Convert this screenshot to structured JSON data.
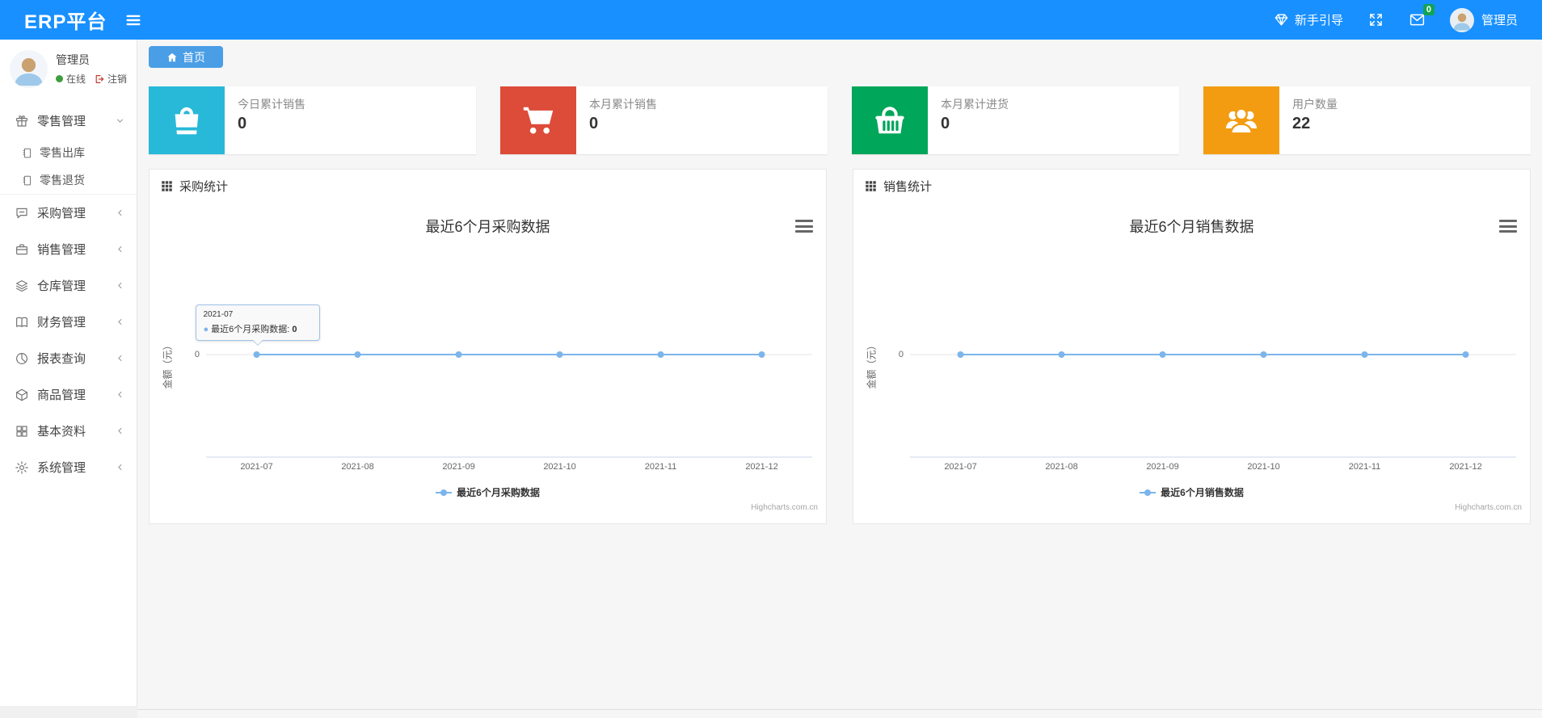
{
  "colors": {
    "navbar_bg": "#1890ff",
    "breadcrumb_tab_bg": "#4a9ee6",
    "badge_green": "#12a352",
    "online_green": "#3c9e3c",
    "logout_red": "#c0392b",
    "chart_line": "#7cb5ec"
  },
  "navbar": {
    "brand": "ERP平台",
    "guide_label": "新手引导",
    "mail_badge": "0",
    "username": "管理员"
  },
  "sidebar": {
    "user": {
      "name": "管理员",
      "status": "在线",
      "logout": "注销"
    },
    "menu": [
      {
        "key": "retail",
        "label": "零售管理",
        "icon": "gift-icon",
        "expanded": true,
        "children": [
          {
            "key": "retail-out",
            "label": "零售出库",
            "icon": "notebook-icon"
          },
          {
            "key": "retail-return",
            "label": "零售退货",
            "icon": "notebook-icon"
          }
        ]
      },
      {
        "key": "purchase",
        "label": "采购管理",
        "icon": "chat-icon"
      },
      {
        "key": "sales",
        "label": "销售管理",
        "icon": "briefcase-icon"
      },
      {
        "key": "warehouse",
        "label": "仓库管理",
        "icon": "layers-icon"
      },
      {
        "key": "finance",
        "label": "财务管理",
        "icon": "book-icon"
      },
      {
        "key": "report",
        "label": "报表查询",
        "icon": "clock-icon"
      },
      {
        "key": "goods",
        "label": "商品管理",
        "icon": "box-icon"
      },
      {
        "key": "basic",
        "label": "基本资料",
        "icon": "grid-icon"
      },
      {
        "key": "system",
        "label": "系统管理",
        "icon": "gear-icon"
      }
    ]
  },
  "breadcrumb": {
    "home_label": "首页"
  },
  "stat_cards": [
    {
      "key": "today-sales",
      "label": "今日累计销售",
      "value": "0",
      "color": "#28b9d8",
      "icon": "shopping-bag-icon"
    },
    {
      "key": "month-sales",
      "label": "本月累计销售",
      "value": "0",
      "color": "#dd4b39",
      "icon": "cart-icon"
    },
    {
      "key": "month-purchase",
      "label": "本月累计进货",
      "value": "0",
      "color": "#00a65a",
      "icon": "basket-icon"
    },
    {
      "key": "user-count",
      "label": "用户数量",
      "value": "22",
      "color": "#f39c12",
      "icon": "users-icon"
    }
  ],
  "panels": [
    {
      "key": "purchase-stats",
      "title": "采购统计"
    },
    {
      "key": "sales-stats",
      "title": "销售统计"
    }
  ],
  "chart_data": [
    {
      "type": "line",
      "title": "最近6个月采购数据",
      "categories": [
        "2021-07",
        "2021-08",
        "2021-09",
        "2021-10",
        "2021-11",
        "2021-12"
      ],
      "series": [
        {
          "name": "最近6个月采购数据",
          "values": [
            0,
            0,
            0,
            0,
            0,
            0
          ]
        }
      ],
      "ylabel": "金额（元）",
      "yticks": [
        "0"
      ],
      "ylim": [
        -1,
        1
      ],
      "grid": true,
      "legend_position": "bottom",
      "line_color": "#7cb5ec",
      "watermark": "Highcharts.com.cn",
      "tooltip": {
        "header": "2021-07",
        "label": "最近6个月采购数据",
        "value": "0",
        "point_index": 0
      }
    },
    {
      "type": "line",
      "title": "最近6个月销售数据",
      "categories": [
        "2021-07",
        "2021-08",
        "2021-09",
        "2021-10",
        "2021-11",
        "2021-12"
      ],
      "series": [
        {
          "name": "最近6个月销售数据",
          "values": [
            0,
            0,
            0,
            0,
            0,
            0
          ]
        }
      ],
      "ylabel": "金额（元）",
      "yticks": [
        "0"
      ],
      "ylim": [
        -1,
        1
      ],
      "grid": true,
      "legend_position": "bottom",
      "line_color": "#7cb5ec",
      "watermark": "Highcharts.com.cn",
      "tooltip": null
    }
  ]
}
